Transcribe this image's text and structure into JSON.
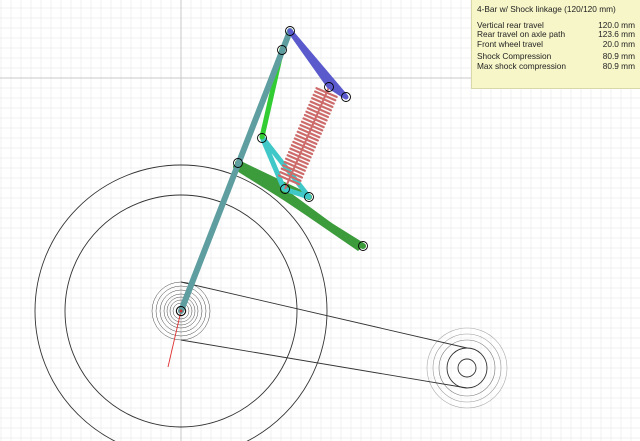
{
  "panel": {
    "title": "4-Bar w/ Shock linkage (120/120 mm)",
    "rows": [
      {
        "label": "Vertical rear travel",
        "value": "120.0 mm"
      },
      {
        "label": "Rear travel on axle path",
        "value": "123.6 mm"
      },
      {
        "label": "Front wheel travel",
        "value": "20.0 mm"
      },
      {
        "label": "Shock Compression",
        "value": "80.9 mm"
      },
      {
        "label": "Max shock compression",
        "value": "80.9 mm"
      }
    ]
  },
  "colors": {
    "seat_tube": "#5f9ea0",
    "rocker": "#5a5acd",
    "front_link": "#32cd32",
    "seat_stay": "#40c8c8",
    "chain_stay": "#3c9c3c",
    "shock_spring": "#cd6b6b",
    "grid": "#e6e6e6",
    "wheel": "#333333",
    "axis": "#c8c8c8"
  }
}
